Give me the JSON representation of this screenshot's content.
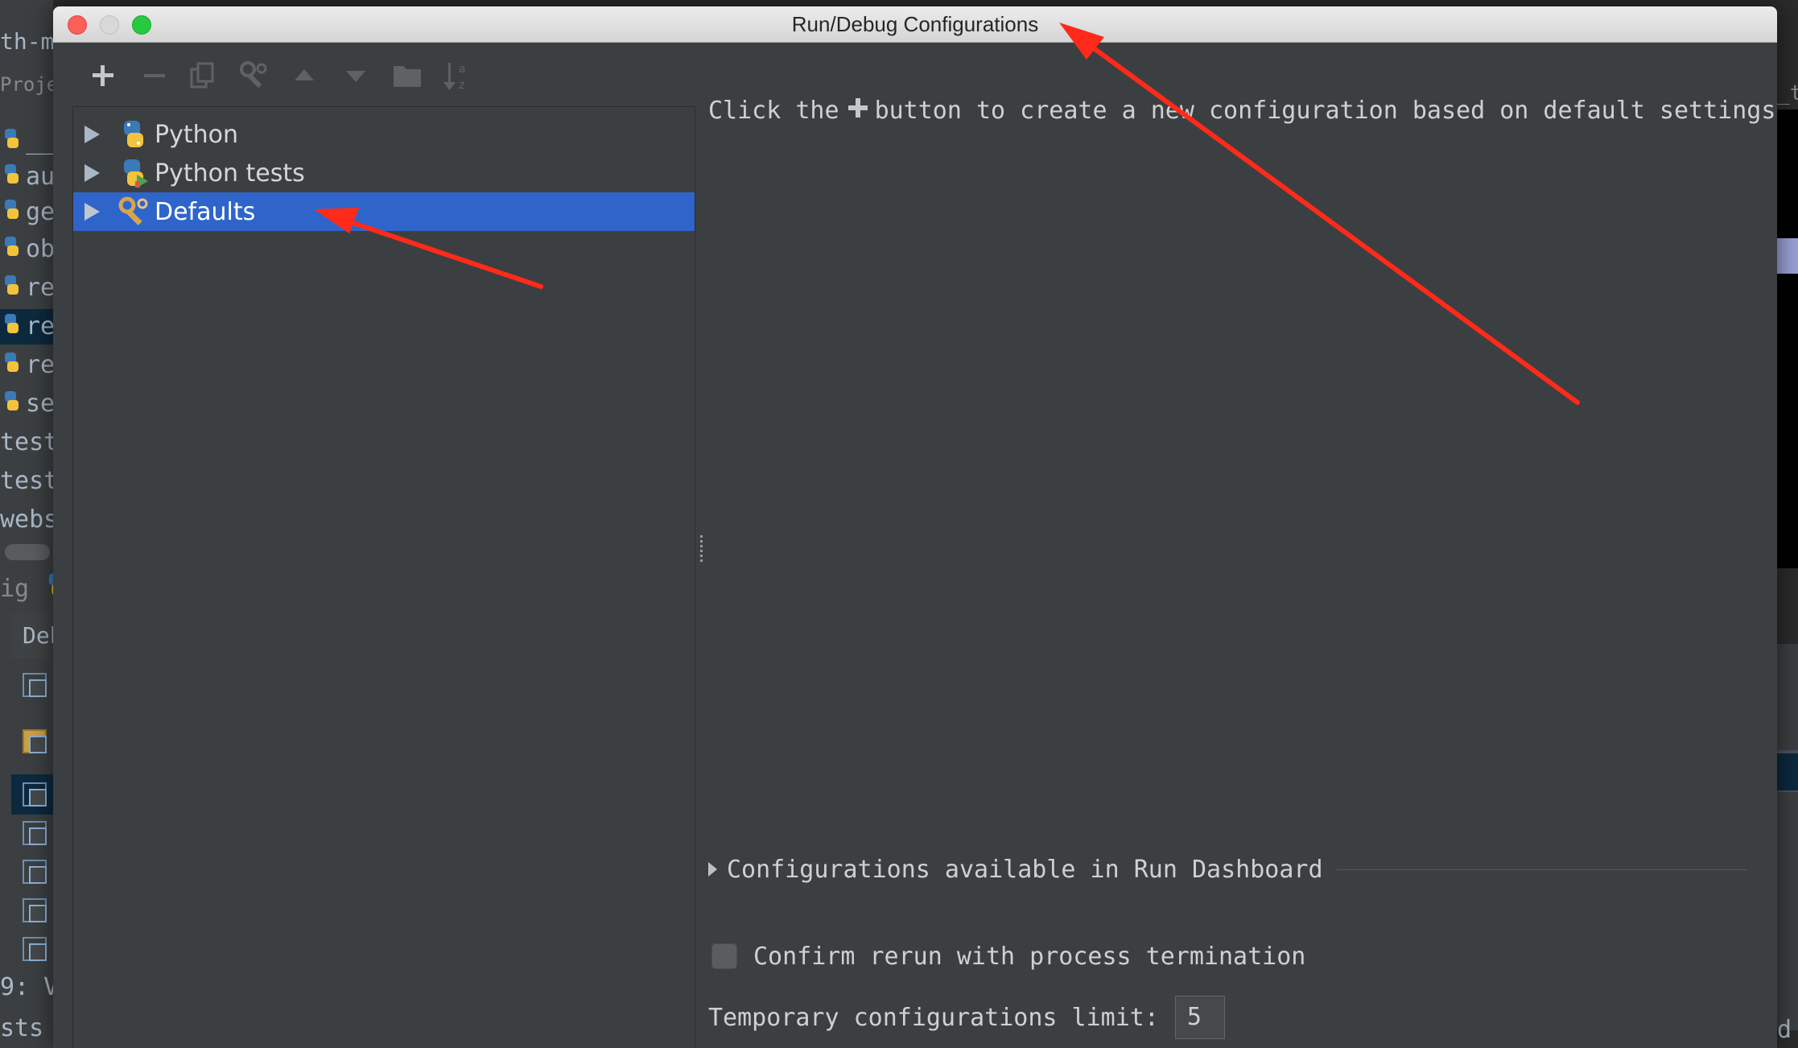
{
  "background_ide": {
    "top_text": "th-m",
    "project_tab": "Proje",
    "rows": [
      "__",
      "au",
      "ge",
      "ob",
      "re",
      "re",
      "re",
      "se",
      "tests",
      "tests",
      "webse"
    ],
    "run_label": "ig",
    "debug_tab": "Deb",
    "bottom_tab": "9: V",
    "status_text": "sts F",
    "right_text": "_t",
    "right_bottom_text": "d"
  },
  "dialog": {
    "title": "Run/Debug Configurations"
  },
  "toolbar": {
    "icons": [
      "plus-icon",
      "minus-icon",
      "copy-icon",
      "wrench-icon",
      "up-arrow-icon",
      "down-arrow-icon",
      "folder-icon",
      "sort-alpha-icon"
    ]
  },
  "tree": {
    "items": [
      {
        "label": "Python",
        "icon": "python-icon",
        "selected": false
      },
      {
        "label": "Python tests",
        "icon": "python-tests-icon",
        "selected": false
      },
      {
        "label": "Defaults",
        "icon": "wrench-icon",
        "selected": true
      }
    ]
  },
  "right_panel": {
    "hint_before": "Click the",
    "hint_after": "button to create a new configuration based on default settings",
    "dashboard_label": "Configurations available in Run Dashboard",
    "confirm_label": "Confirm rerun with process termination",
    "confirm_checked": false,
    "temp_limit_label": "Temporary configurations limit:",
    "temp_limit_value": "5"
  },
  "colors": {
    "selection": "#2f65ca",
    "panel": "#3c3f41",
    "annotation_arrow": "#ff2a1a"
  }
}
